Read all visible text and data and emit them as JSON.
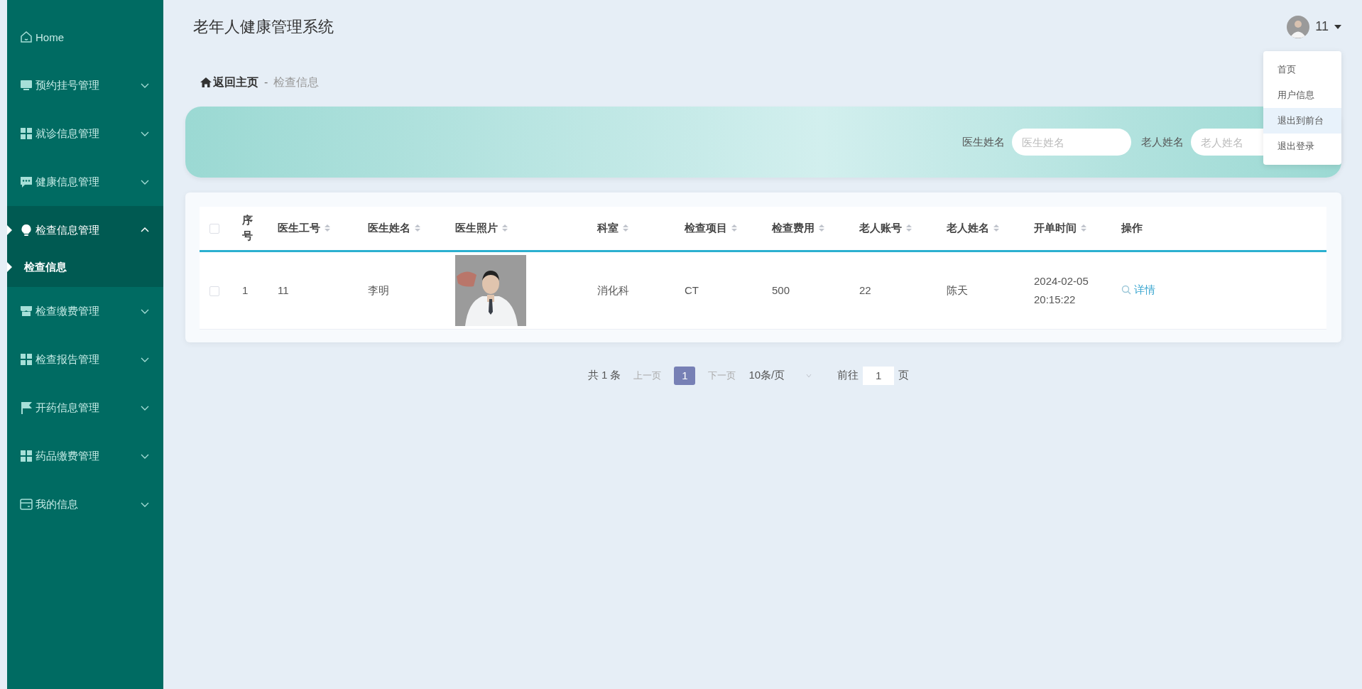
{
  "sidebar": {
    "items": [
      {
        "label": "Home",
        "kind": "link",
        "selected": false
      },
      {
        "label": "预约挂号管理",
        "kind": "group",
        "expanded": false,
        "selected": false
      },
      {
        "label": "就诊信息管理",
        "kind": "group",
        "expanded": false,
        "selected": false
      },
      {
        "label": "健康信息管理",
        "kind": "group",
        "expanded": false,
        "selected": false
      },
      {
        "label": "检查信息管理",
        "kind": "group",
        "expanded": true,
        "selected": true,
        "children": [
          {
            "label": "检查信息",
            "selected": true
          }
        ]
      },
      {
        "label": "检查缴费管理",
        "kind": "group",
        "expanded": false,
        "selected": false
      },
      {
        "label": "检查报告管理",
        "kind": "group",
        "expanded": false,
        "selected": false
      },
      {
        "label": "开药信息管理",
        "kind": "group",
        "expanded": false,
        "selected": false
      },
      {
        "label": "药品缴费管理",
        "kind": "group",
        "expanded": false,
        "selected": false
      },
      {
        "label": "我的信息",
        "kind": "group",
        "expanded": false,
        "selected": false
      }
    ]
  },
  "header": {
    "title": "老年人健康管理系统",
    "user": {
      "name": "11",
      "menu_open": true,
      "menu": [
        {
          "label": "首页",
          "selected": false
        },
        {
          "label": "用户信息",
          "selected": false
        },
        {
          "label": "退出到前台",
          "selected": true
        },
        {
          "label": "退出登录",
          "selected": false
        }
      ]
    }
  },
  "breadcrumb": {
    "home": "返回主页",
    "separator": "-",
    "current": "检查信息"
  },
  "search": {
    "fields": [
      {
        "label": "医生姓名",
        "placeholder": "医生姓名"
      },
      {
        "label": "老人姓名",
        "placeholder": "老人姓名"
      }
    ]
  },
  "table": {
    "select_all_checked": false,
    "columns": [
      {
        "label": "序号",
        "sortable": false
      },
      {
        "label": "医生工号",
        "sortable": true
      },
      {
        "label": "医生姓名",
        "sortable": true
      },
      {
        "label": "医生照片",
        "sortable": true
      },
      {
        "label": "科室",
        "sortable": true
      },
      {
        "label": "检查项目",
        "sortable": true
      },
      {
        "label": "检查费用",
        "sortable": true
      },
      {
        "label": "老人账号",
        "sortable": true
      },
      {
        "label": "老人姓名",
        "sortable": true
      },
      {
        "label": "开单时间",
        "sortable": true
      },
      {
        "label": "操作",
        "sortable": false
      }
    ],
    "rows": [
      {
        "checked": false,
        "cells": [
          {
            "kind": "text",
            "text": "1"
          },
          {
            "kind": "text",
            "text": "11"
          },
          {
            "kind": "text",
            "text": "李明"
          },
          {
            "kind": "picture"
          },
          {
            "kind": "text",
            "text": "消化科"
          },
          {
            "kind": "text",
            "text": "CT"
          },
          {
            "kind": "text",
            "text": "500"
          },
          {
            "kind": "text",
            "text": "22"
          },
          {
            "kind": "text",
            "text": "陈天"
          },
          {
            "kind": "text",
            "text": "2024-02-05 20:15:22"
          },
          {
            "kind": "action",
            "text": "详情"
          }
        ]
      }
    ]
  },
  "pagination": {
    "total": "共 1 条",
    "prev": {
      "label": "上一页",
      "disabled": true
    },
    "pages": [
      {
        "label": "1",
        "selected": true
      }
    ],
    "next": {
      "label": "下一页",
      "disabled": true
    },
    "page_size": "10条/页",
    "goto_label": "前往",
    "goto_value": "1",
    "goto_unit": "页"
  }
}
